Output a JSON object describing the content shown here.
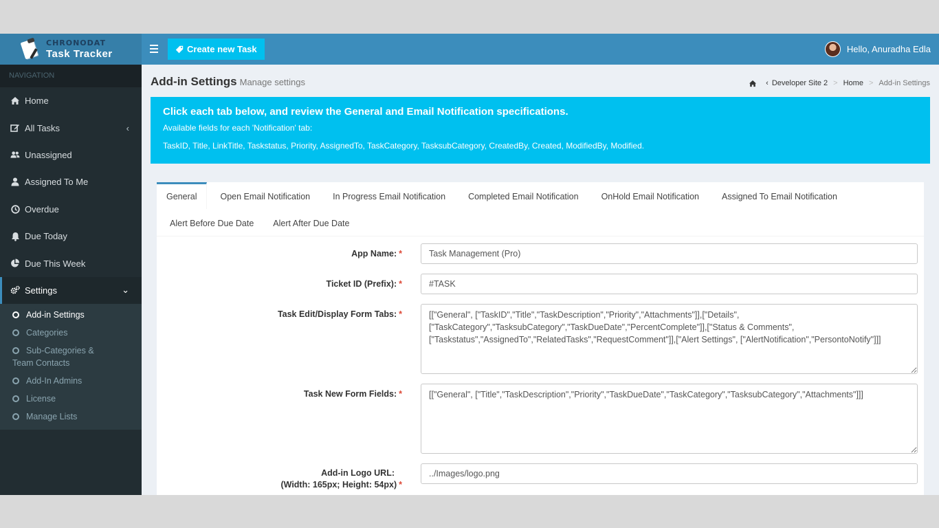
{
  "brand": {
    "company": "CHRONODAT",
    "product": "Task Tracker"
  },
  "header": {
    "create_label": "Create new Task",
    "greeting": "Hello, Anuradha Edla"
  },
  "sidebar": {
    "heading": "NAVIGATION",
    "items": [
      {
        "label": "Home",
        "icon": "home-icon"
      },
      {
        "label": "All Tasks",
        "icon": "edit-icon"
      },
      {
        "label": "Unassigned",
        "icon": "users-icon"
      },
      {
        "label": "Assigned To Me",
        "icon": "user-icon"
      },
      {
        "label": "Overdue",
        "icon": "clock-icon"
      },
      {
        "label": "Due Today",
        "icon": "bell-icon"
      },
      {
        "label": "Due This Week",
        "icon": "pie-chart-icon"
      },
      {
        "label": "Settings",
        "icon": "gears-icon"
      }
    ],
    "settings_sub": [
      "Add-in Settings",
      "Categories",
      "Sub-Categories &",
      "Team Contacts",
      "Add-In Admins",
      "License",
      "Manage Lists"
    ]
  },
  "page": {
    "title": "Add-in Settings",
    "subtitle": "Manage settings"
  },
  "breadcrumb": {
    "site": "Developer Site 2",
    "home": "Home",
    "current": "Add-in Settings"
  },
  "callout": {
    "title": "Click each tab below, and review the General and Email Notification specifications.",
    "line1": "Available fields for each 'Notification' tab:",
    "line2": "TaskID, Title, LinkTitle, Taskstatus, Priority, AssignedTo, TaskCategory, TasksubCategory, CreatedBy, Created, ModifiedBy, Modified."
  },
  "tabs": [
    "General",
    "Open Email Notification",
    "In Progress Email Notification",
    "Completed Email Notification",
    "OnHold Email Notification",
    "Assigned To Email Notification",
    "Alert Before Due Date",
    "Alert After Due Date"
  ],
  "form": {
    "app_name": {
      "label": "App Name:",
      "value": "Task Management (Pro)"
    },
    "ticket_id": {
      "label": "Ticket ID (Prefix):",
      "value": "#TASK"
    },
    "edit_tabs": {
      "label": "Task Edit/Display Form Tabs:",
      "value": "[[\"General\", [\"TaskID\",\"Title\",\"TaskDescription\",\"Priority\",\"Attachments\"]],[\"Details\", [\"TaskCategory\",\"TasksubCategory\",\"TaskDueDate\",\"PercentComplete\"]],[\"Status & Comments\", [\"Taskstatus\",\"AssignedTo\",\"RelatedTasks\",\"RequestComment\"]],[\"Alert Settings\", [\"AlertNotification\",\"PersontoNotify\"]]]"
    },
    "new_fields": {
      "label": "Task New Form Fields:",
      "value": "[[\"General\", [\"Title\",\"TaskDescription\",\"Priority\",\"TaskDueDate\",\"TaskCategory\",\"TasksubCategory\",\"Attachments\"]]]"
    },
    "logo_url": {
      "label": "Add-in Logo URL:",
      "label2": "(Width: 165px; Height: 54px)",
      "value": "../Images/logo.png"
    },
    "required_mark": "*"
  }
}
